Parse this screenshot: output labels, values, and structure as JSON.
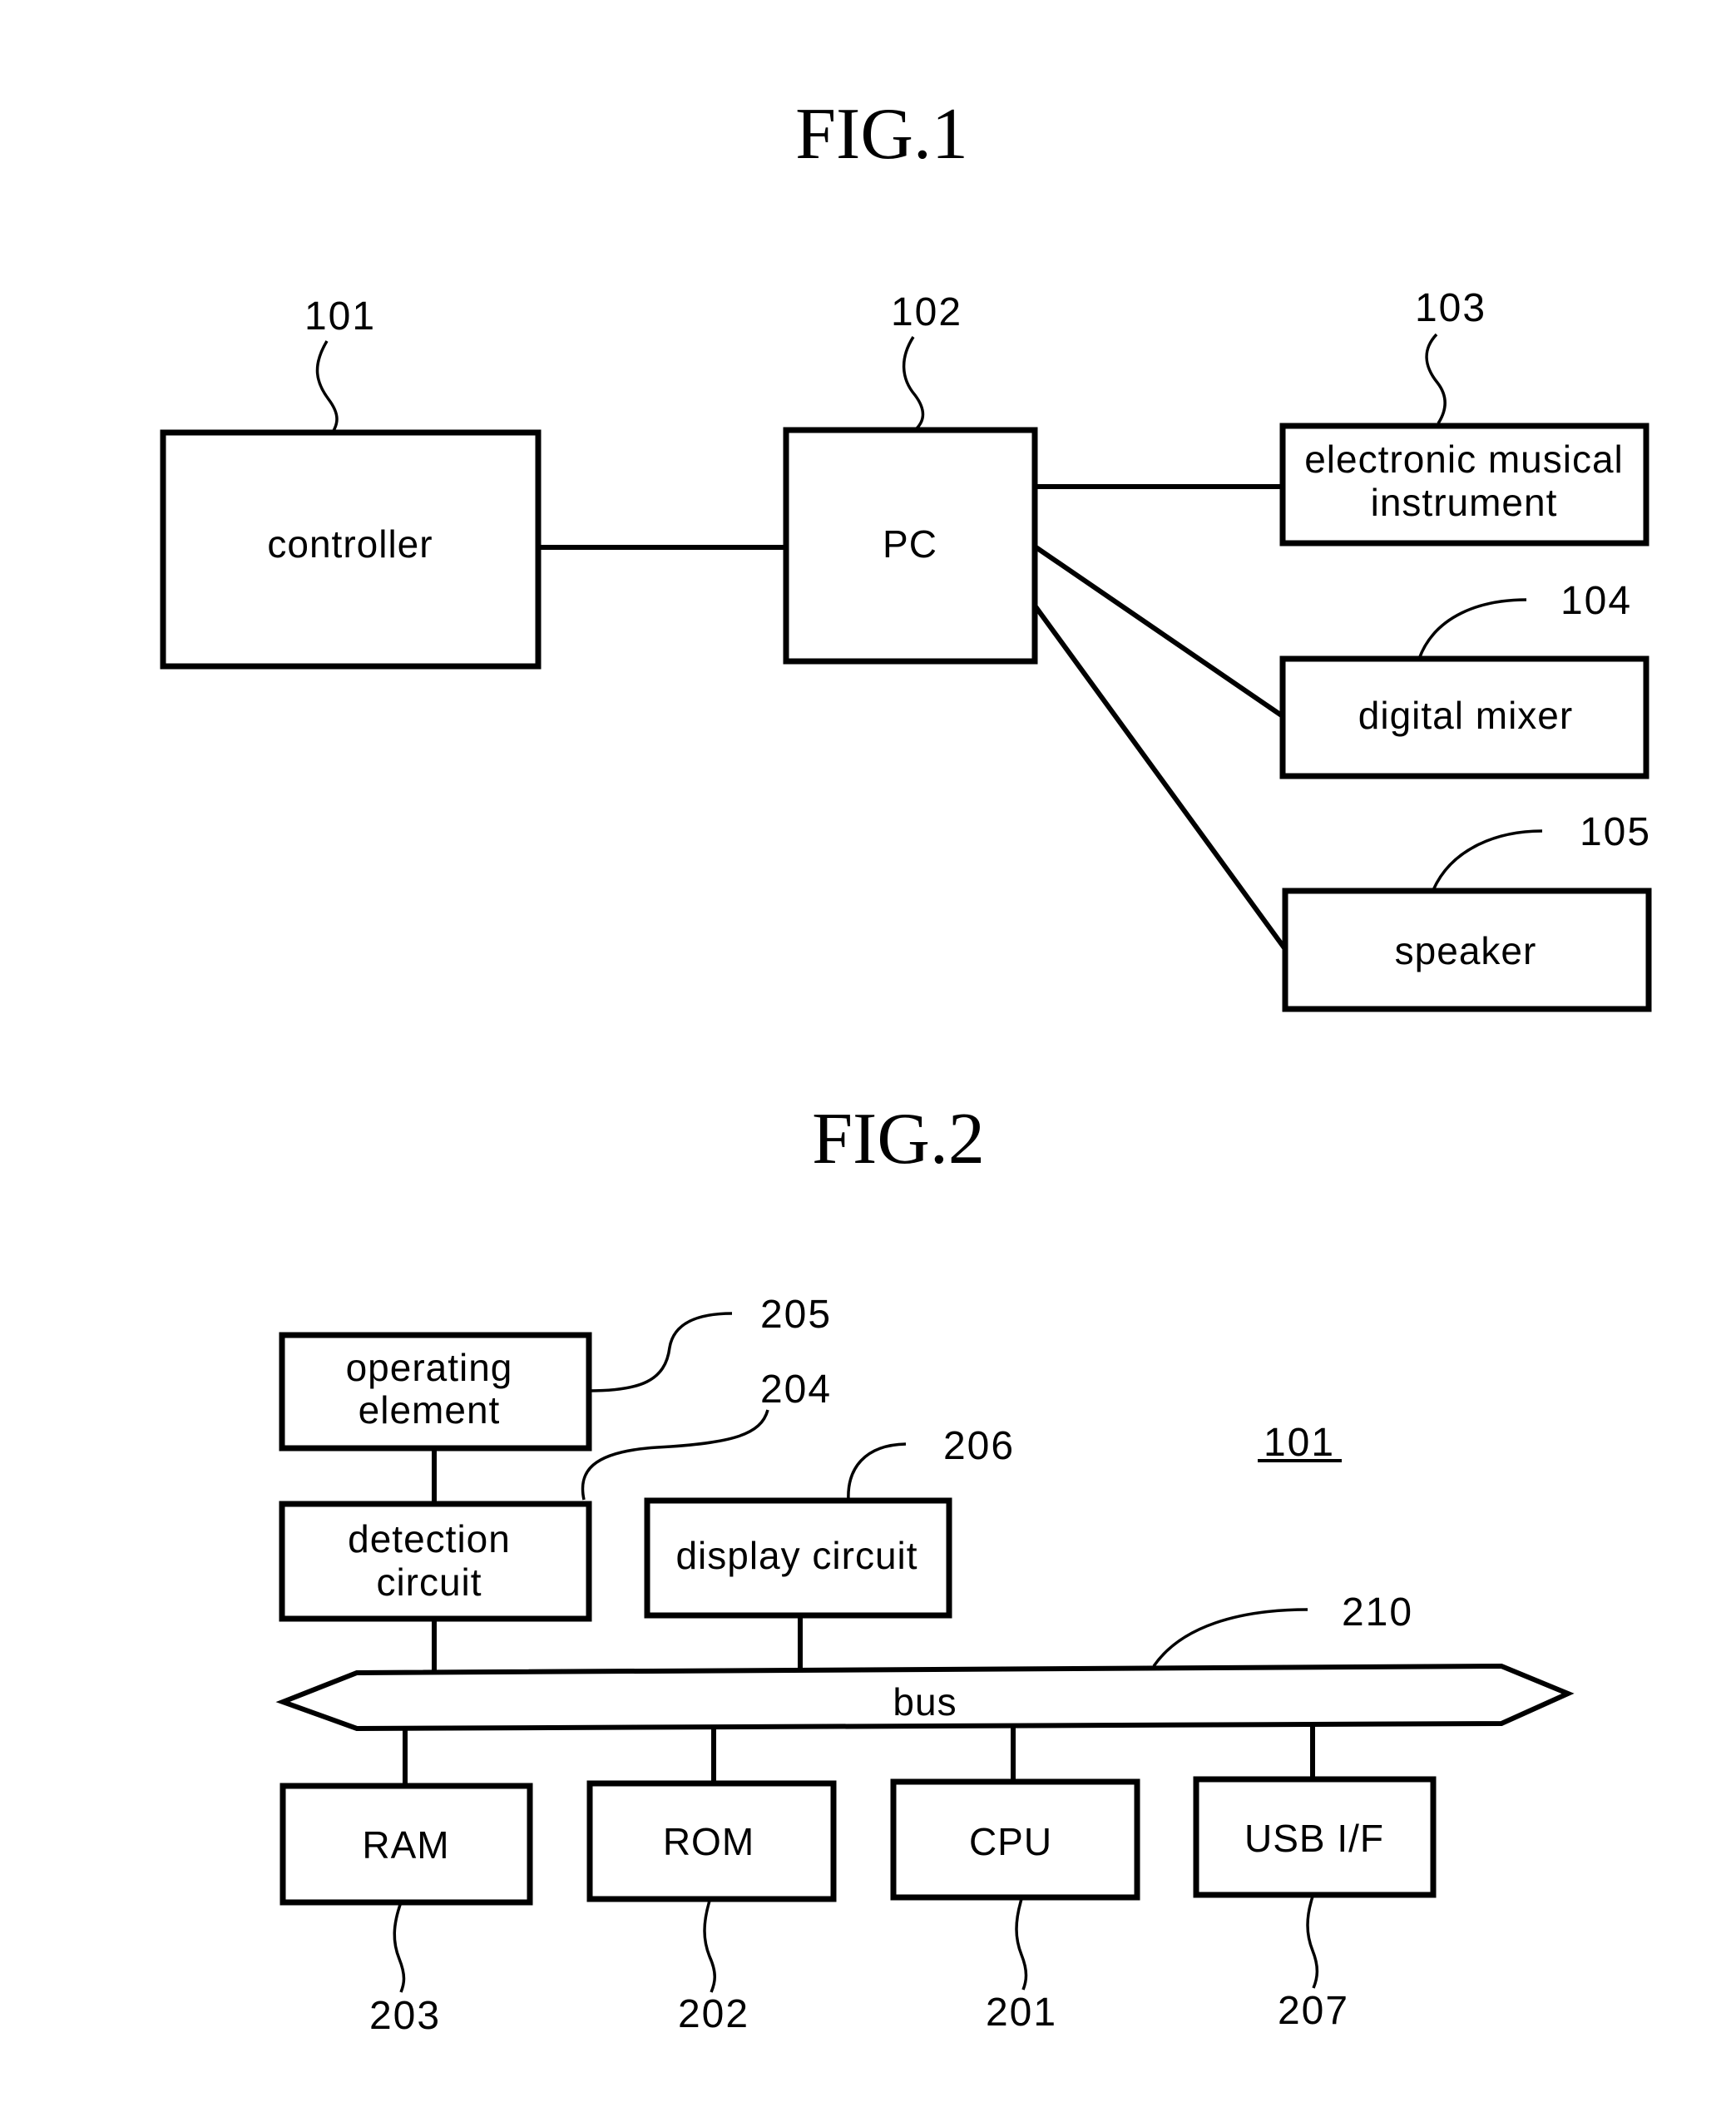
{
  "figures": [
    {
      "title": "FIG.1",
      "blocks": [
        {
          "ref": "101",
          "label_lines": [
            "controller"
          ]
        },
        {
          "ref": "102",
          "label_lines": [
            "PC"
          ]
        },
        {
          "ref": "103",
          "label_lines": [
            "electronic musical",
            "instrument"
          ]
        },
        {
          "ref": "104",
          "label_lines": [
            "digital mixer"
          ]
        },
        {
          "ref": "105",
          "label_lines": [
            "speaker"
          ]
        }
      ],
      "connections": [
        [
          "101",
          "102"
        ],
        [
          "102",
          "103"
        ],
        [
          "102",
          "104"
        ],
        [
          "102",
          "105"
        ]
      ]
    },
    {
      "title": "FIG.2",
      "device_ref": "101",
      "blocks": [
        {
          "ref": "205",
          "label_lines": [
            "operating",
            "element"
          ]
        },
        {
          "ref": "204",
          "label_lines": [
            "detection",
            "circuit"
          ]
        },
        {
          "ref": "206",
          "label_lines": [
            "display circuit"
          ]
        },
        {
          "ref": "210",
          "label_lines": [
            "bus"
          ]
        },
        {
          "ref": "203",
          "label_lines": [
            "RAM"
          ]
        },
        {
          "ref": "202",
          "label_lines": [
            "ROM"
          ]
        },
        {
          "ref": "201",
          "label_lines": [
            "CPU"
          ]
        },
        {
          "ref": "207",
          "label_lines": [
            "USB I/F"
          ]
        }
      ],
      "connections": [
        [
          "205",
          "204"
        ],
        [
          "204",
          "210"
        ],
        [
          "206",
          "210"
        ],
        [
          "210",
          "203"
        ],
        [
          "210",
          "202"
        ],
        [
          "210",
          "201"
        ],
        [
          "210",
          "207"
        ]
      ]
    }
  ]
}
